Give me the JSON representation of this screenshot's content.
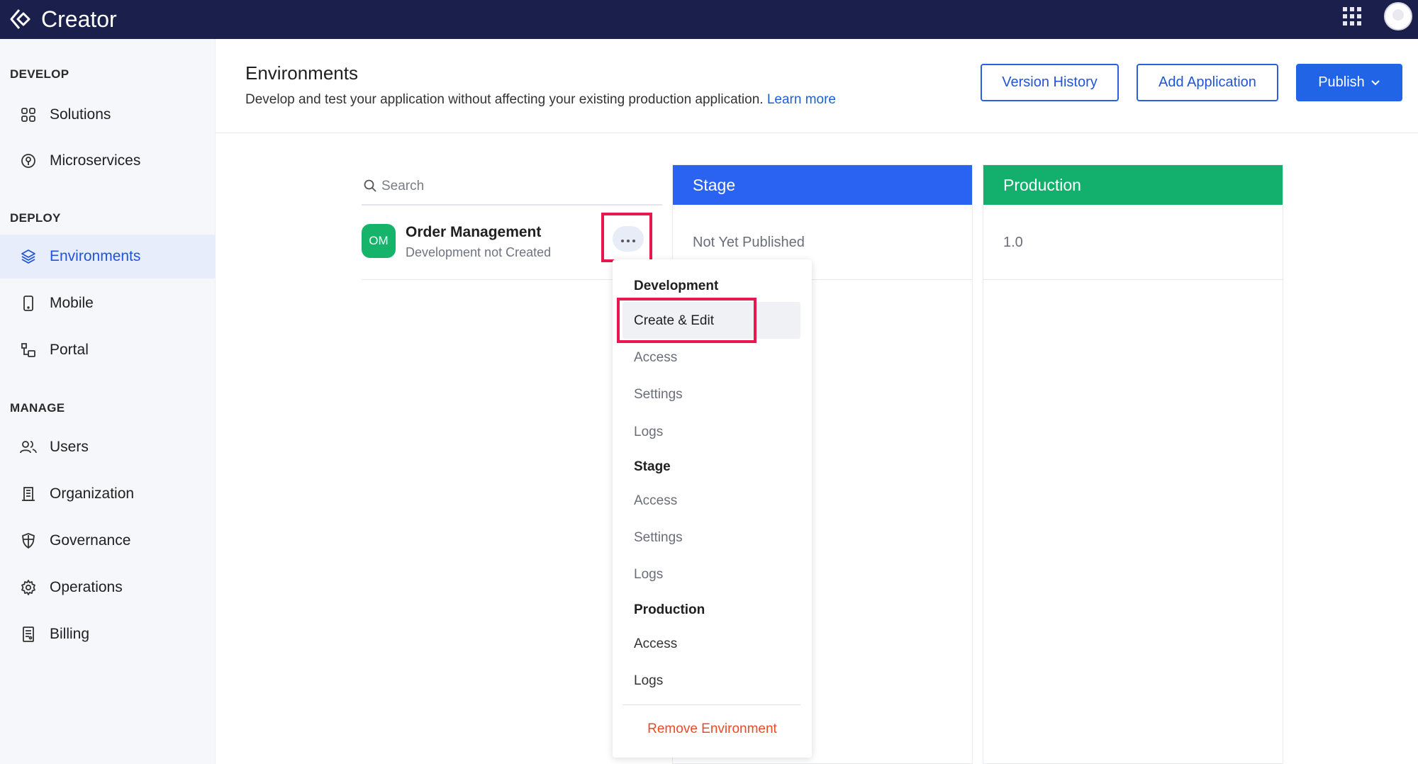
{
  "app": {
    "name": "Creator",
    "icons": {
      "brand": "creator-logo-icon",
      "apps": "app-grid-icon",
      "avatar": "user-avatar-icon"
    }
  },
  "sidebar": {
    "sections": [
      {
        "label": "DEVELOP",
        "items": [
          {
            "label": "Solutions",
            "icon": "grid-icon"
          },
          {
            "label": "Microservices",
            "icon": "microservices-icon"
          }
        ]
      },
      {
        "label": "DEPLOY",
        "items": [
          {
            "label": "Environments",
            "icon": "layers-icon",
            "active": true
          },
          {
            "label": "Mobile",
            "icon": "mobile-icon"
          },
          {
            "label": "Portal",
            "icon": "portal-icon"
          }
        ]
      },
      {
        "label": "MANAGE",
        "items": [
          {
            "label": "Users",
            "icon": "users-icon"
          },
          {
            "label": "Organization",
            "icon": "building-icon"
          },
          {
            "label": "Governance",
            "icon": "shield-icon"
          },
          {
            "label": "Operations",
            "icon": "gear-icon"
          },
          {
            "label": "Billing",
            "icon": "billing-icon"
          }
        ]
      }
    ]
  },
  "header": {
    "title": "Environments",
    "description": "Develop and test your application without affecting your existing production application.",
    "learn_more": "Learn more",
    "buttons": {
      "version_history": "Version History",
      "add_application": "Add Application",
      "publish": "Publish"
    }
  },
  "search": {
    "placeholder": "Search"
  },
  "application": {
    "initials": "OM",
    "name": "Order Management",
    "status": "Development not Created"
  },
  "columns": {
    "stage": {
      "title": "Stage",
      "value": "Not Yet Published",
      "color": "#2a62f2"
    },
    "production": {
      "title": "Production",
      "value": "1.0",
      "color": "#12b06c"
    }
  },
  "menu": {
    "development": {
      "heading": "Development",
      "items": [
        "Create & Edit",
        "Access",
        "Settings",
        "Logs"
      ]
    },
    "stage": {
      "heading": "Stage",
      "items": [
        "Access",
        "Settings",
        "Logs"
      ]
    },
    "production": {
      "heading": "Production",
      "items": [
        "Access",
        "Logs"
      ]
    },
    "remove": "Remove Environment"
  },
  "colors": {
    "topbar": "#1b1f4b",
    "accent": "#2264e6",
    "highlight": "#e8174f",
    "danger": "#ea4a28"
  }
}
